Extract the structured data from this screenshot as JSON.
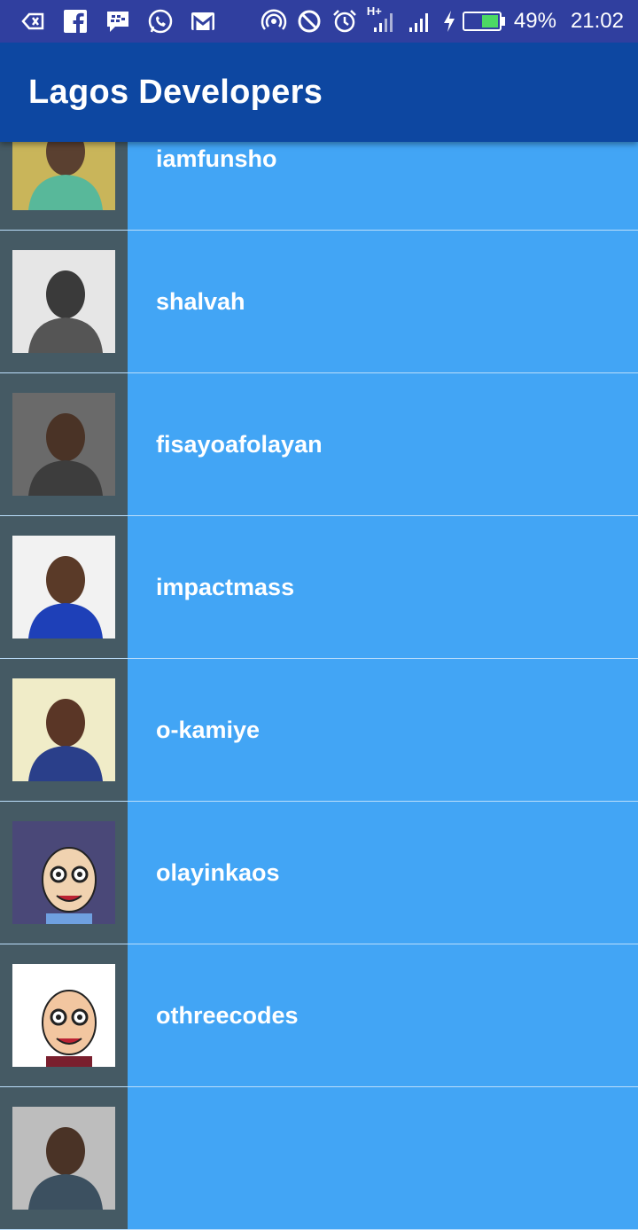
{
  "status_bar": {
    "icons_left": [
      "back-arrow-icon",
      "facebook-icon",
      "bbm-icon",
      "whatsapp-icon",
      "gmail-icon"
    ],
    "icons_right": [
      "hotspot-icon",
      "do-not-disturb-icon",
      "alarm-icon",
      "signal-h-plus-icon",
      "signal-icon",
      "charging-icon",
      "battery-icon"
    ],
    "network_label": "H+",
    "battery_percent": "49%",
    "battery_level": 0.49,
    "time": "21:02"
  },
  "app_bar": {
    "title": "Lagos Developers"
  },
  "developers": [
    {
      "username": "iamfunsho",
      "avatar": "photo-avatar"
    },
    {
      "username": "shalvah",
      "avatar": "photo-avatar"
    },
    {
      "username": "fisayoafolayan",
      "avatar": "photo-avatar"
    },
    {
      "username": "impactmass",
      "avatar": "photo-avatar"
    },
    {
      "username": "o-kamiye",
      "avatar": "photo-avatar"
    },
    {
      "username": "olayinkaos",
      "avatar": "cartoon-avatar"
    },
    {
      "username": "othreecodes",
      "avatar": "cartoon-avatar"
    },
    {
      "username": "",
      "avatar": "photo-avatar"
    }
  ],
  "colors": {
    "status_bar": "#303f9f",
    "app_bar": "#0d47a1",
    "row_background": "#42a5f5",
    "avatar_column": "#455a64"
  }
}
